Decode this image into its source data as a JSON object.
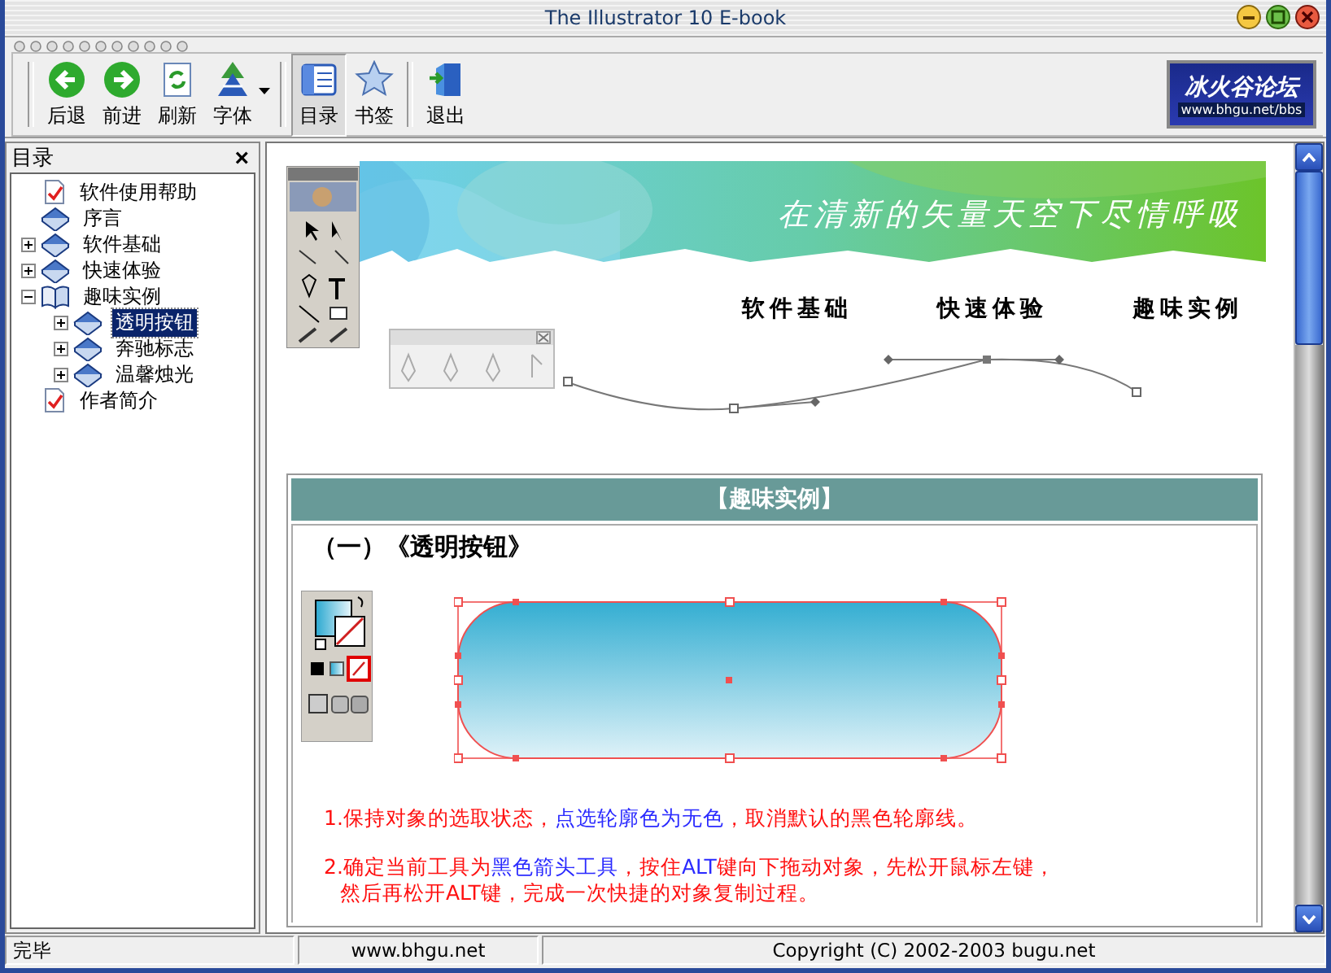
{
  "window": {
    "title": "The Illustrator 10 E-book"
  },
  "toolbar": {
    "groups": [
      [
        {
          "label": "后退",
          "kind": "back",
          "selected": false,
          "dropdown": false
        },
        {
          "label": "前进",
          "kind": "forward",
          "selected": false,
          "dropdown": false
        },
        {
          "label": "刷新",
          "kind": "refresh",
          "selected": false,
          "dropdown": false
        },
        {
          "label": "字体",
          "kind": "font",
          "selected": false,
          "dropdown": true
        }
      ],
      [
        {
          "label": "目录",
          "kind": "toc",
          "selected": true,
          "dropdown": false
        },
        {
          "label": "书签",
          "kind": "bookmark",
          "selected": false,
          "dropdown": false
        }
      ],
      [
        {
          "label": "退出",
          "kind": "exit",
          "selected": false,
          "dropdown": false
        }
      ]
    ]
  },
  "logo": {
    "name": "冰火谷论坛",
    "url": "www.bhgu.net/bbs"
  },
  "sidebar": {
    "title": "目录",
    "close": "×",
    "tree": [
      {
        "label": "软件使用帮助",
        "kind": "page",
        "selected": false
      },
      {
        "label": "序言",
        "kind": "book",
        "selected": false
      },
      {
        "label": "软件基础",
        "kind": "book",
        "expanded": false,
        "selected": false
      },
      {
        "label": "快速体验",
        "kind": "book",
        "expanded": false,
        "selected": false
      },
      {
        "label": "趣味实例",
        "kind": "book",
        "expanded": true,
        "selected": false,
        "children": [
          {
            "label": "透明按钮",
            "kind": "book",
            "expanded": false,
            "selected": true
          },
          {
            "label": "奔驰标志",
            "kind": "book",
            "expanded": false,
            "selected": false
          },
          {
            "label": "温馨烛光",
            "kind": "book",
            "expanded": false,
            "selected": false
          }
        ]
      },
      {
        "label": "作者简介",
        "kind": "page",
        "selected": false
      }
    ]
  },
  "page": {
    "slogan": "在清新的矢量天空下尽情呼吸",
    "nav": [
      "软件基础",
      "快速体验",
      "趣味实例"
    ],
    "section_title": "【趣味实例】",
    "heading": "（一）《透明按钮》",
    "steps": [
      {
        "lines": [
          [
            {
              "text": "1.保持对象的选取状态，",
              "highlight": false
            },
            {
              "text": "点选轮廓色为无色",
              "highlight": true
            },
            {
              "text": "，取消默认的黑色轮廓线。",
              "highlight": false
            }
          ]
        ]
      },
      {
        "lines": [
          [
            {
              "text": "2.确定当前工具为",
              "highlight": false
            },
            {
              "text": "黑色箭头工具",
              "highlight": true
            },
            {
              "text": "，按住",
              "highlight": false
            },
            {
              "text": "ALT",
              "highlight": true
            },
            {
              "text": "键向下拖动对象，先松开鼠标左键，",
              "highlight": false
            }
          ],
          [
            {
              "text": "然后再松开ALT键，完成一次快捷的对象复制过程。",
              "highlight": false
            }
          ]
        ]
      }
    ]
  },
  "status_bar": [
    "完毕",
    "www.bhgu.net",
    "Copyright (C) 2002-2003 bugu.net"
  ]
}
